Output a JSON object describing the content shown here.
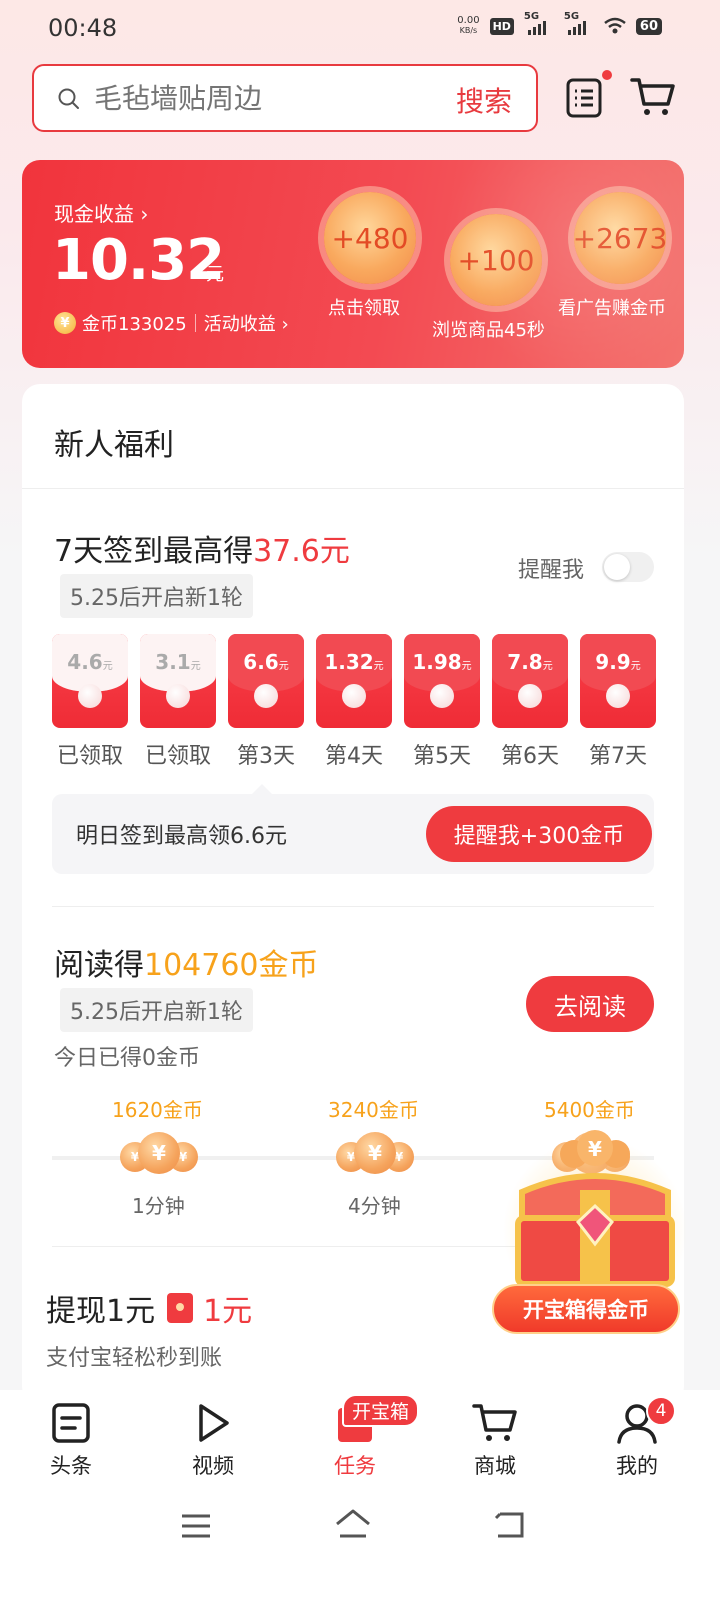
{
  "status_bar": {
    "time": "00:48",
    "net_speed_value": "0.00",
    "net_speed_unit": "KB/s",
    "hd": "HD",
    "sim1": "5G",
    "sim2": "5G",
    "battery": "60"
  },
  "search": {
    "placeholder": "毛毡墙贴周边",
    "button": "搜索"
  },
  "earnings": {
    "cash_label": "现金收益 ›",
    "cash_value": "10.32",
    "cash_unit": "元",
    "coins_label": "金币133025",
    "activity_label": "活动收益 ›",
    "bubbles": [
      {
        "value": "+480",
        "label": "点击领取"
      },
      {
        "value": "+100",
        "label": "浏览商品45秒"
      },
      {
        "value": "+2673",
        "label": "看广告赚金币"
      }
    ]
  },
  "newbie": {
    "title": "新人福利"
  },
  "signin": {
    "title_prefix": "7天签到最高得",
    "title_highlight": "37.6元",
    "round_note": "5.25后开启新1轮",
    "remind_label": "提醒我",
    "remind_on": false,
    "yuan_unit": "元",
    "days": [
      {
        "amount": "4.6",
        "label": "已领取",
        "claimed": true
      },
      {
        "amount": "3.1",
        "label": "已领取",
        "claimed": true
      },
      {
        "amount": "6.6",
        "label": "第3天",
        "claimed": false
      },
      {
        "amount": "1.32",
        "label": "第4天",
        "claimed": false
      },
      {
        "amount": "1.98",
        "label": "第5天",
        "claimed": false
      },
      {
        "amount": "7.8",
        "label": "第6天",
        "claimed": false
      },
      {
        "amount": "9.9",
        "label": "第7天",
        "claimed": false
      }
    ],
    "tip_text": "明日签到最高领6.6元",
    "tip_button": "提醒我+300金币"
  },
  "reading": {
    "title_prefix": "阅读得",
    "title_highlight": "104760金币",
    "round_note": "5.25后开启新1轮",
    "today": "今日已得0金币",
    "button": "去阅读",
    "milestones": [
      {
        "coins": "1620金币",
        "time": "1分钟"
      },
      {
        "coins": "3240金币",
        "time": "4分钟"
      },
      {
        "coins": "5400金币",
        "time": ""
      }
    ]
  },
  "withdraw": {
    "title": "提现1元",
    "amount": "1元",
    "subtitle": "支付宝轻松秒到账"
  },
  "chest": {
    "button": "开宝箱得金币"
  },
  "bottom_nav": {
    "items": [
      {
        "label": "头条",
        "icon": "news-icon"
      },
      {
        "label": "视频",
        "icon": "play-icon"
      },
      {
        "label": "任务",
        "icon": "task-icon",
        "badge": "开宝箱"
      },
      {
        "label": "商城",
        "icon": "cart-icon"
      },
      {
        "label": "我的",
        "icon": "person-icon",
        "badge": "4"
      }
    ]
  },
  "colors": {
    "accent_red": "#ef3b3f",
    "coin_orange": "#f7a21b"
  }
}
